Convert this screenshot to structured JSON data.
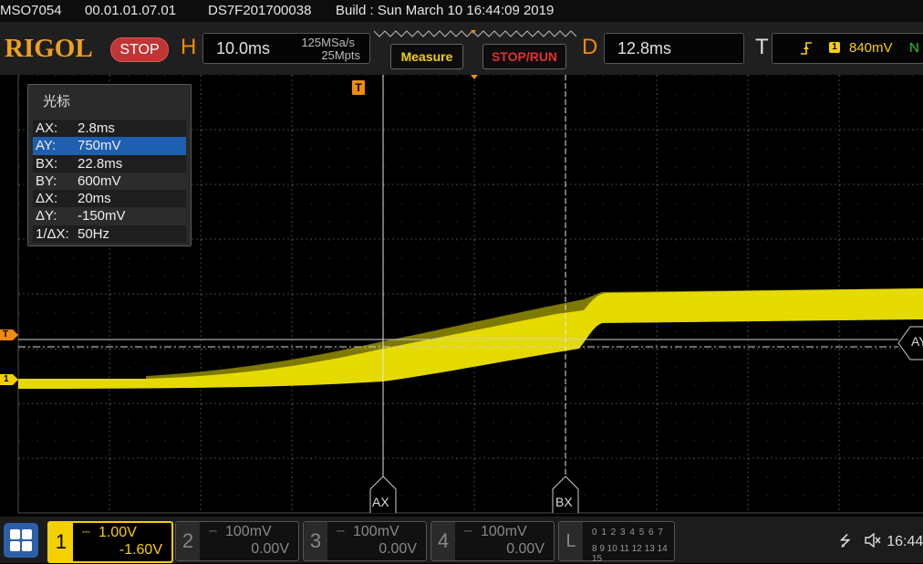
{
  "info_bar": {
    "model": "MSO7054",
    "firmware": "00.01.01.07.01",
    "serial": "DS7F201700038",
    "build": "Build : Sun March 10 16:44:09 2019"
  },
  "toolbar": {
    "logo": "RIGOL",
    "run_state": "STOP",
    "horizontal_letter": "H",
    "timebase": "10.0ms",
    "sample_rate": "125MSa/s",
    "memory_depth": "25Mpts",
    "measure_label": "Measure",
    "stop_run_label": "STOP/RUN",
    "delay_letter": "D",
    "delay": "12.8ms",
    "trigger_letter": "T",
    "trigger_slope_icon": "rising-edge-icon",
    "trigger_channel": "1",
    "trigger_level": "840mV",
    "trigger_mode": "N"
  },
  "cursor_panel": {
    "title": "光标",
    "rows": [
      {
        "key": "AX:",
        "value": "2.8ms"
      },
      {
        "key": "AY:",
        "value": "750mV"
      },
      {
        "key": "BX:",
        "value": "22.8ms"
      },
      {
        "key": "BY:",
        "value": "600mV"
      },
      {
        "key": "ΔX:",
        "value": "20ms"
      },
      {
        "key": "ΔY:",
        "value": "-150mV"
      },
      {
        "key": "1/ΔX:",
        "value": "50Hz"
      }
    ],
    "selected_row": 1
  },
  "markers": {
    "trigger_position": "T",
    "trigger_level_marker": "T",
    "channel1_marker": "1",
    "cursor_ax": "AX",
    "cursor_bx": "BX",
    "cursor_ay": "AY"
  },
  "channels": [
    {
      "num": "1",
      "scale": "1.00V",
      "offset": "-1.60V",
      "active": true
    },
    {
      "num": "2",
      "scale": "100mV",
      "offset": "0.00V",
      "active": false
    },
    {
      "num": "3",
      "scale": "100mV",
      "offset": "0.00V",
      "active": false
    },
    {
      "num": "4",
      "scale": "100mV",
      "offset": "0.00V",
      "active": false
    }
  ],
  "logic": {
    "label": "L",
    "row1": "0 1 2 3  4 5 6 7",
    "row2": "8 9 10 11 12 13 14 15"
  },
  "status": {
    "usb_icon": "usb-icon",
    "speaker_icon": "speaker-muted-icon",
    "clock": "16:44"
  },
  "colors": {
    "channel1": "#f5d000",
    "accent": "#f08a10",
    "stop": "#c03535"
  }
}
